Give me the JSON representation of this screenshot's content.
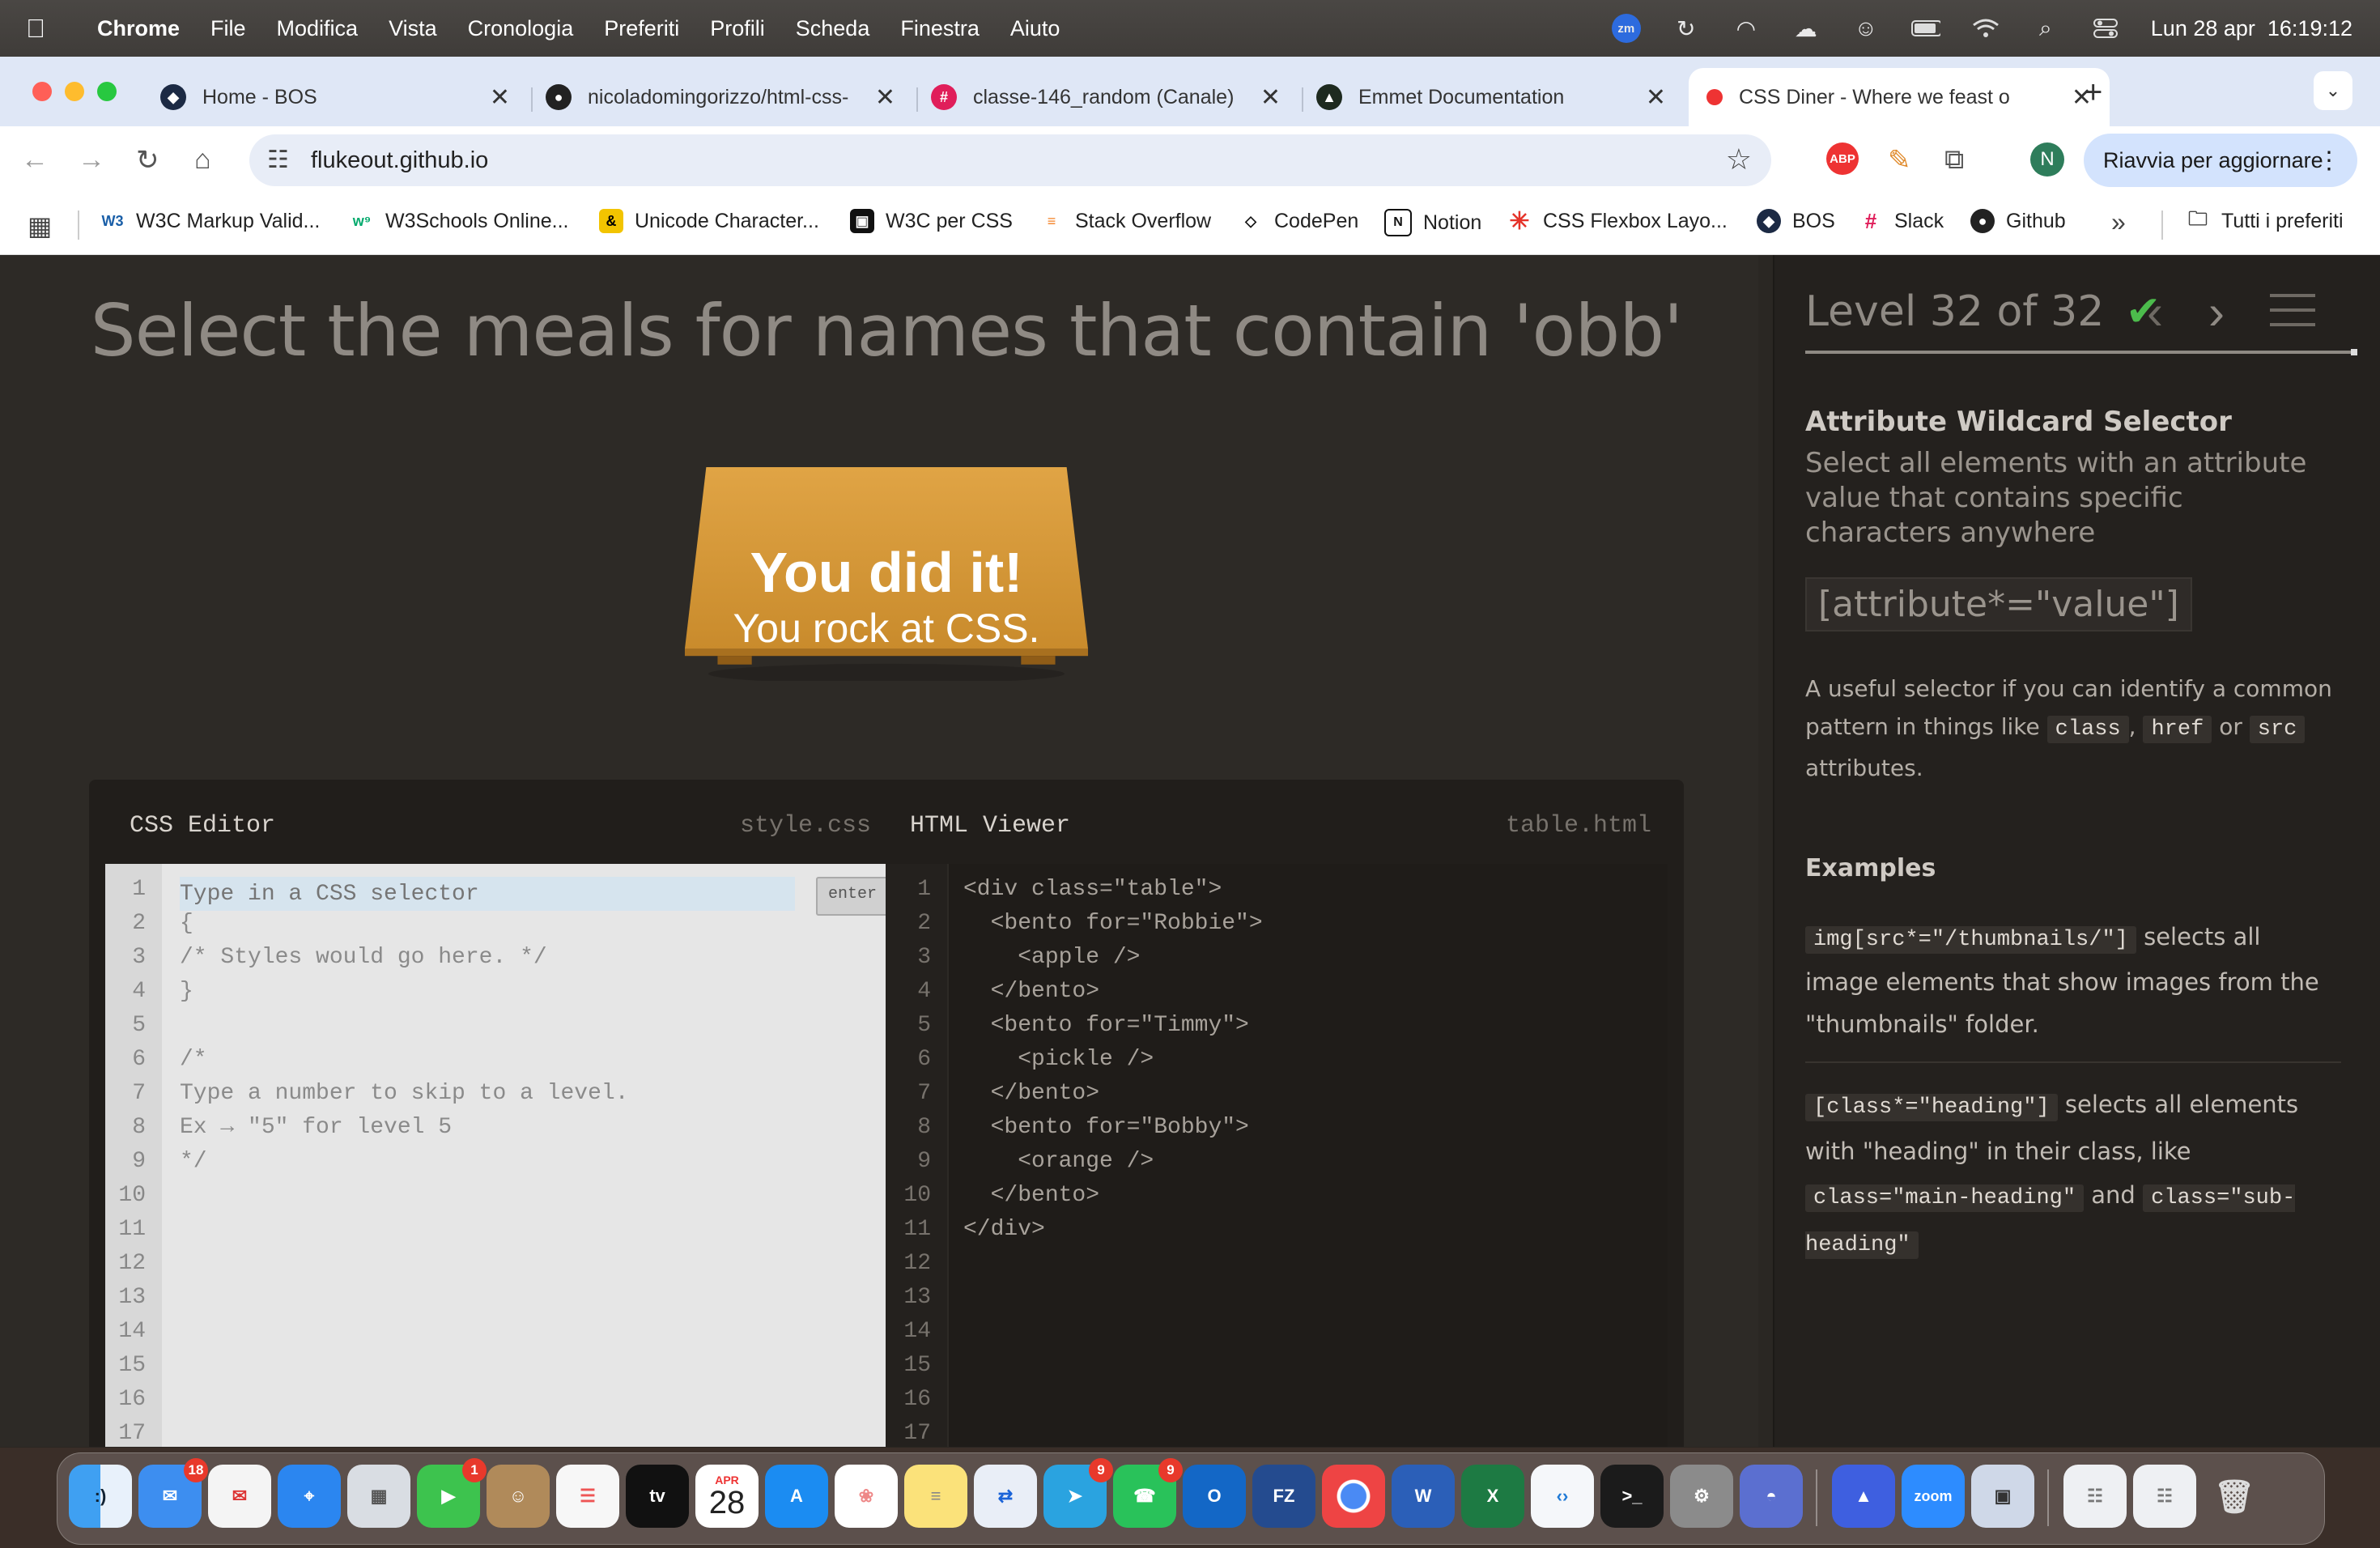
{
  "menubar": {
    "app": "Chrome",
    "items": [
      "File",
      "Modifica",
      "Vista",
      "Cronologia",
      "Preferiti",
      "Profili",
      "Scheda",
      "Finestra",
      "Aiuto"
    ],
    "clock": "Lun 28 apr  16:19:12",
    "zoom_label": "zm"
  },
  "tabs": [
    {
      "title": "Home - BOS",
      "icon": "bos-icon"
    },
    {
      "title": "nicoladomingorizzo/html-css-",
      "icon": "github-icon"
    },
    {
      "title": "classe-146_random (Canale)",
      "icon": "slack-icon"
    },
    {
      "title": "Emmet Documentation",
      "icon": "emmet-icon"
    },
    {
      "title": "CSS Diner - Where we feast o",
      "icon": "css-diner-icon"
    }
  ],
  "toolbar": {
    "url": "flukeout.github.io",
    "update_label": "Riavvia per aggiornare",
    "profile_initial": "N"
  },
  "bookmarks": [
    {
      "label": "W3C Markup Valid...",
      "icon": "W3"
    },
    {
      "label": "W3Schools Online...",
      "icon": "w3"
    },
    {
      "label": "Unicode Character...",
      "icon": "&"
    },
    {
      "label": "W3C per CSS",
      "icon": "css"
    },
    {
      "label": "Stack Overflow",
      "icon": "so"
    },
    {
      "label": "CodePen",
      "icon": "cp"
    },
    {
      "label": "Notion",
      "icon": "N"
    },
    {
      "label": "CSS Flexbox Layo...",
      "icon": "*"
    },
    {
      "label": "BOS",
      "icon": "bos"
    },
    {
      "label": "Slack",
      "icon": "#"
    },
    {
      "label": "Github",
      "icon": "gh"
    }
  ],
  "bookmarks_all": "Tutti i preferiti",
  "game": {
    "order": "Select the meals for names that contain 'obb'",
    "win_title": "You did it!",
    "win_sub": "You rock at CSS.",
    "css_editor_title": "CSS Editor",
    "css_file": "style.css",
    "html_viewer_title": "HTML Viewer",
    "html_file": "table.html",
    "input_placeholder": "Type in a CSS selector",
    "enter_label": "enter",
    "css_lines": [
      "",
      "{",
      "/* Styles would go here. */",
      "}",
      "",
      "/*",
      "Type a number to skip to a level.",
      "Ex → \"5\" for level 5",
      "*/",
      "",
      "",
      "",
      "",
      "",
      "",
      "",
      ""
    ],
    "html_lines": [
      "<div class=\"table\">",
      "  <bento for=\"Robbie\">",
      "    <apple />",
      "  </bento>",
      "  <bento for=\"Timmy\">",
      "    <pickle />",
      "  </bento>",
      "  <bento for=\"Bobby\">",
      "    <orange />",
      "  </bento>",
      "</div>",
      "",
      "",
      "",
      "",
      "",
      ""
    ],
    "line_numbers": [
      "1",
      "2",
      "3",
      "4",
      "5",
      "6",
      "7",
      "8",
      "9",
      "10",
      "11",
      "12",
      "13",
      "14",
      "15",
      "16",
      "17"
    ]
  },
  "level": {
    "label": "Level 32 of 32",
    "check": "✔",
    "selector_name": "Attribute Wildcard Selector",
    "title": "Select all elements with an attribute value that contains specific characters anywhere",
    "syntax": "[attribute*=\"value\"]",
    "hint_before": "A useful selector if you can identify a common pattern in things like",
    "hint_codes": [
      "class",
      "href",
      "src"
    ],
    "hint_or": "or",
    "hint_after": "attributes.",
    "examples_title": "Examples",
    "example1_code": "img[src*=\"/thumbnails/\"]",
    "example1_text": "selects all image elements that show images from the \"thumbnails\" folder.",
    "example2_code": "[class*=\"heading\"]",
    "example2_text": "selects all elements with \"heading\" in their class, like",
    "example2_code2": "class=\"main-heading\"",
    "example2_and": "and",
    "example2_code3": "class=\"sub-heading\""
  },
  "dock": {
    "mail_badge": "18",
    "facetime_badge": "1",
    "calendar_month": "APR",
    "calendar_day": "28",
    "telegram_badge": "9",
    "whatsapp_badge": "9",
    "tv_label": "tv",
    "zoom_label": "zoom"
  },
  "colors": {
    "accent_check": "#4cbb4c",
    "table_wood": "#d99a3b",
    "tab_strip": "#dfe7f6",
    "page_bg": "#2d2a26"
  }
}
